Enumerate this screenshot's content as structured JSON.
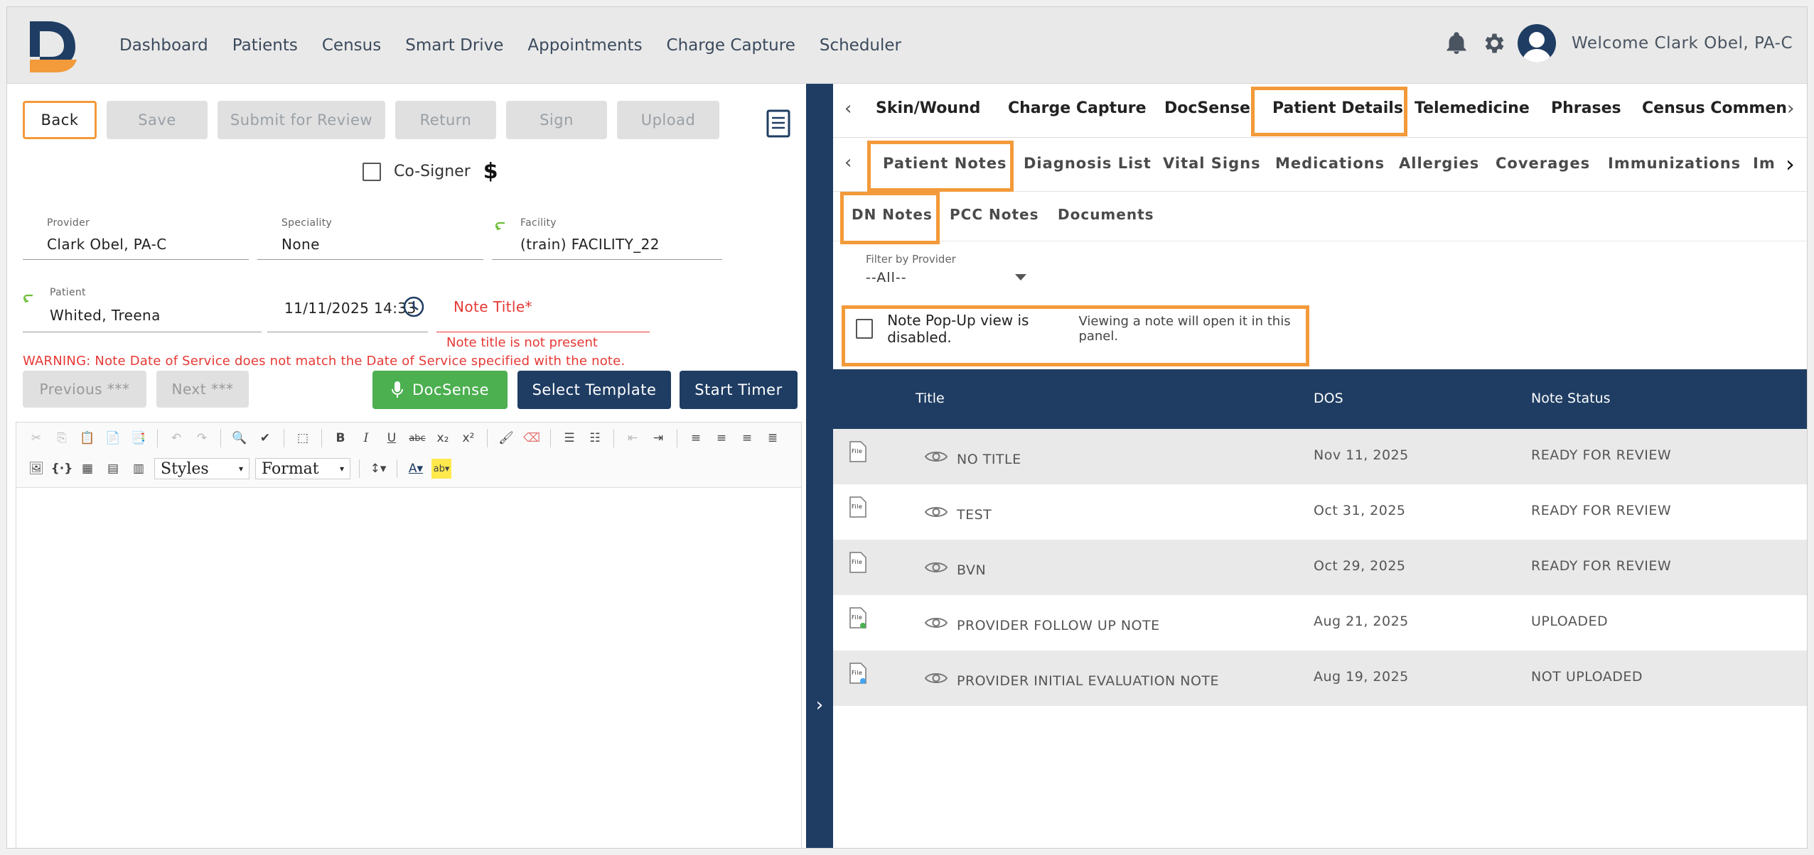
{
  "nav": [
    "Dashboard",
    "Patients",
    "Census",
    "Smart Drive",
    "Appointments",
    "Charge Capture",
    "Scheduler"
  ],
  "header": {
    "welcome": "Welcome Clark Obel, PA-C"
  },
  "actions": {
    "back": "Back",
    "save": "Save",
    "submit": "Submit for Review",
    "return": "Return",
    "sign": "Sign",
    "upload": "Upload"
  },
  "cosigner": {
    "label": "Co-Signer",
    "dollar": "$"
  },
  "fields": {
    "provider_label": "Provider",
    "provider_value": "Clark Obel, PA-C",
    "speciality_label": "Speciality",
    "speciality_value": "None",
    "facility_label": "Facility",
    "facility_value": "(train) FACILITY_22",
    "patient_label": "Patient",
    "patient_value": "Whited, Treena",
    "dos_value": "11/11/2025 14:33",
    "note_title_placeholder": "Note Title*",
    "note_title_error": "Note title is not present"
  },
  "warning": "WARNING: Note Date of Service does not match the Date of Service specified with the note.",
  "nav_buttons": {
    "previous": "Previous ***",
    "next": "Next ***"
  },
  "tool_buttons": {
    "docsense": "DocSense",
    "select_template": "Select Template",
    "start_timer": "Start Timer"
  },
  "editor": {
    "styles": "Styles",
    "format": "Format"
  },
  "tabs_main": [
    "Skin/Wound",
    "Charge Capture",
    "DocSense",
    "Patient Details",
    "Telemedicine",
    "Phrases",
    "Census Commen"
  ],
  "tabs_sub": [
    "Patient Notes",
    "Diagnosis List",
    "Vital Signs",
    "Medications",
    "Allergies",
    "Coverages",
    "Immunizations",
    "Im"
  ],
  "tabs_notes": [
    "DN Notes",
    "PCC Notes",
    "Documents"
  ],
  "filter": {
    "label": "Filter by Provider",
    "value": "--All--"
  },
  "popup": {
    "main": "Note Pop-Up view is disabled.",
    "sub": "Viewing a note will open it in this panel."
  },
  "table": {
    "headers": [
      "Title",
      "DOS",
      "Note Status"
    ],
    "file_label": "File",
    "rows": [
      {
        "title": "NO TITLE",
        "dos": "Nov 11, 2025",
        "status": "READY FOR REVIEW"
      },
      {
        "title": "TEST",
        "dos": "Oct 31, 2025",
        "status": "READY FOR REVIEW"
      },
      {
        "title": "BVN",
        "dos": "Oct 29, 2025",
        "status": "READY FOR REVIEW"
      },
      {
        "title": "PROVIDER FOLLOW UP NOTE",
        "dos": "Aug 21, 2025",
        "status": "UPLOADED"
      },
      {
        "title": "PROVIDER INITIAL EVALUATION NOTE",
        "dos": "Aug 19, 2025",
        "status": "NOT UPLOADED"
      }
    ]
  },
  "colors": {
    "accent": "#f39a3a",
    "navy": "#1f3d63",
    "green": "#4caf50",
    "error": "#e53935"
  }
}
